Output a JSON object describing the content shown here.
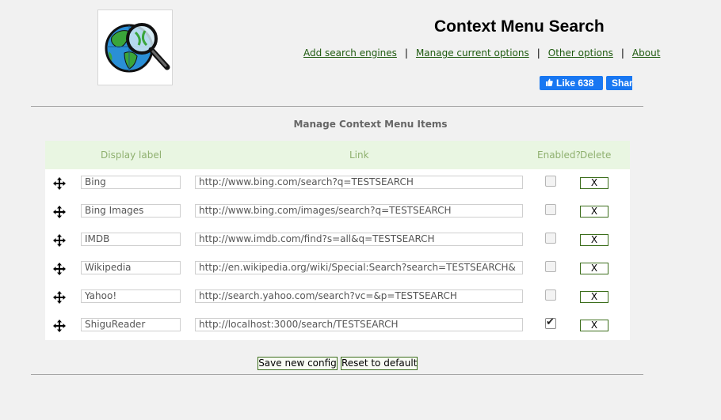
{
  "header": {
    "title": "Context Menu Search",
    "links": [
      "Add search engines",
      "Manage current options",
      "Other options",
      "About"
    ],
    "separator": "|",
    "fb_like_label": "Like 638",
    "fb_share_label": "Share"
  },
  "section": {
    "title": "Manage Context Menu Items",
    "columns": {
      "label": "Display label",
      "link": "Link",
      "enabled": "Enabled?",
      "delete": "Delete"
    }
  },
  "rows": [
    {
      "label": "Bing",
      "link": "http://www.bing.com/search?q=TESTSEARCH",
      "enabled": false,
      "delete": "X"
    },
    {
      "label": "Bing Images",
      "link": "http://www.bing.com/images/search?q=TESTSEARCH",
      "enabled": false,
      "delete": "X"
    },
    {
      "label": "IMDB",
      "link": "http://www.imdb.com/find?s=all&q=TESTSEARCH",
      "enabled": false,
      "delete": "X"
    },
    {
      "label": "Wikipedia",
      "link": "http://en.wikipedia.org/wiki/Special:Search?search=TESTSEARCH&",
      "enabled": false,
      "delete": "X"
    },
    {
      "label": "Yahoo!",
      "link": "http://search.yahoo.com/search?vc=&p=TESTSEARCH",
      "enabled": false,
      "delete": "X"
    },
    {
      "label": "ShiguReader",
      "link": "http://localhost:3000/search/TESTSEARCH",
      "enabled": true,
      "delete": "X"
    }
  ],
  "actions": {
    "save": "Save new config",
    "reset": "Reset to default"
  },
  "colors": {
    "page_bg": "#f1f1f1",
    "header_bg": "#e9f6e2",
    "header_text": "#8fb06f",
    "link": "#1f5b10",
    "facebook": "#1877f2"
  }
}
